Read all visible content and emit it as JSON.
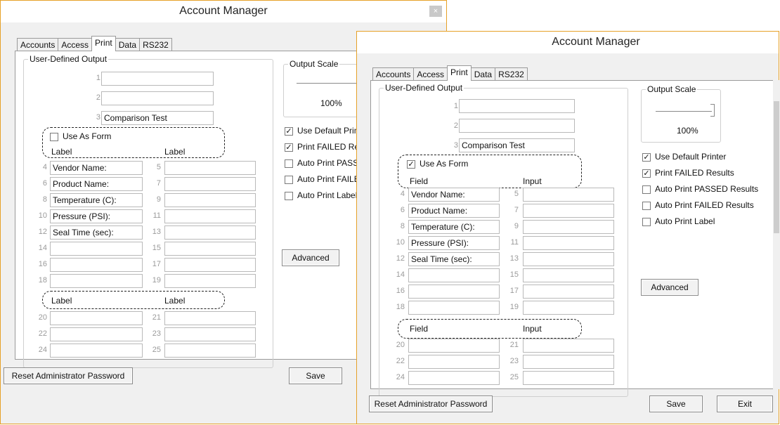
{
  "window_title": "Account Manager",
  "close_glyph": "×",
  "tabs": [
    "Accounts",
    "Access",
    "Print",
    "Data",
    "RS232"
  ],
  "active_tab": "Print",
  "user_defined_output_legend": "User-Defined Output",
  "top_rows": [
    {
      "num": "1",
      "value": ""
    },
    {
      "num": "2",
      "value": ""
    },
    {
      "num": "3",
      "value": "Comparison Test"
    }
  ],
  "field_rows": [
    {
      "left_num": "4",
      "left_value": "Vendor Name:",
      "right_num": "5",
      "right_value": ""
    },
    {
      "left_num": "6",
      "left_value": "Product Name:",
      "right_num": "7",
      "right_value": ""
    },
    {
      "left_num": "8",
      "left_value": "Temperature (C):",
      "right_num": "9",
      "right_value": ""
    },
    {
      "left_num": "10",
      "left_value": "Pressure (PSI):",
      "right_num": "11",
      "right_value": ""
    },
    {
      "left_num": "12",
      "left_value": "Seal Time (sec):",
      "right_num": "13",
      "right_value": ""
    },
    {
      "left_num": "14",
      "left_value": "",
      "right_num": "15",
      "right_value": ""
    },
    {
      "left_num": "16",
      "left_value": "",
      "right_num": "17",
      "right_value": ""
    },
    {
      "left_num": "18",
      "left_value": "",
      "right_num": "19",
      "right_value": ""
    }
  ],
  "bottom_rows": [
    {
      "left_num": "20",
      "left_value": "",
      "right_num": "21",
      "right_value": ""
    },
    {
      "left_num": "22",
      "left_value": "",
      "right_num": "23",
      "right_value": ""
    },
    {
      "left_num": "24",
      "left_value": "",
      "right_num": "25",
      "right_value": ""
    }
  ],
  "use_as_form_label": "Use As Form",
  "check_glyph": "✓",
  "back_window": {
    "use_as_form_checked": false,
    "header_left": "Label",
    "header_right": "Label",
    "lower_header_left": "Label",
    "lower_header_right": "Label",
    "options": [
      {
        "label": "Use Default Prin",
        "checked": true
      },
      {
        "label": "Print FAILED Re",
        "checked": true
      },
      {
        "label": "Auto Print PASS",
        "checked": false
      },
      {
        "label": "Auto Print FAILE",
        "checked": false
      },
      {
        "label": "Auto Print Label",
        "checked": false
      }
    ]
  },
  "front_window": {
    "use_as_form_checked": true,
    "header_left": "Field",
    "header_right": "Input",
    "lower_header_left": "Field",
    "lower_header_right": "Input",
    "options": [
      {
        "label": "Use Default Printer",
        "checked": true
      },
      {
        "label": "Print FAILED Results",
        "checked": true
      },
      {
        "label": "Auto Print PASSED Results",
        "checked": false
      },
      {
        "label": "Auto Print FAILED Results",
        "checked": false
      },
      {
        "label": "Auto Print Label",
        "checked": false
      }
    ]
  },
  "output_scale": {
    "legend": "Output Scale",
    "value_text": "100%",
    "level_percent": 100
  },
  "buttons": {
    "advanced": "Advanced",
    "reset_password": "Reset Administrator Password",
    "save": "Save",
    "exit": "Exit"
  }
}
